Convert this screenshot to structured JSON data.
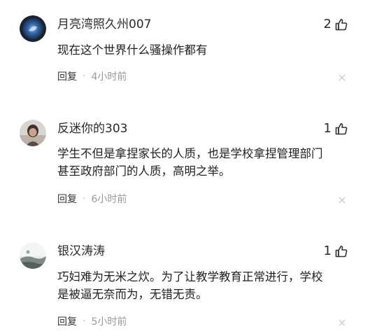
{
  "comments": [
    {
      "username": "月亮湾照久州007",
      "likes": "2",
      "lines": [
        "现在这个世界什么骚操作都有"
      ],
      "reply_label": "回复",
      "separator": "·",
      "time": "4小时前",
      "avatar": "moon-photo-avatar"
    },
    {
      "username": "反迷你的303",
      "likes": "1",
      "lines": [
        "学生不但是拿捏家长的人质，也是学校拿捏管理部门",
        "甚至政府部门的人质，高明之举。"
      ],
      "reply_label": "回复",
      "separator": "·",
      "time": "6小时前",
      "avatar": "person-photo-avatar"
    },
    {
      "username": "银汉涛涛",
      "likes": "1",
      "lines": [
        "巧妇难为无米之炊。为了让教学教育正常进行，学校",
        "是被逼无奈而为，无错无责。"
      ],
      "reply_label": "回复",
      "separator": "·",
      "time": "5小时前",
      "avatar": "landscape-photo-avatar"
    }
  ],
  "icons": {
    "like": "thumbs-up-icon",
    "close": "close-icon"
  },
  "colors": {
    "text": "#222222",
    "meta": "#999999",
    "close": "#cccccc"
  }
}
